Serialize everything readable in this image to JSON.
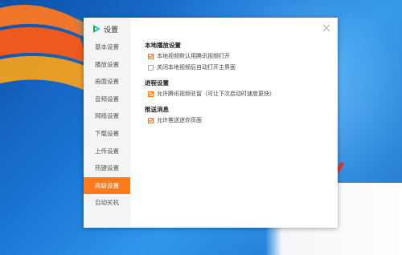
{
  "dialog": {
    "title": "设置",
    "logo_icon": "tencent-video-logo-icon",
    "close_icon": "close-icon",
    "accent_color": "#ff7a1a"
  },
  "sidebar": {
    "items": [
      {
        "label": "基本设置",
        "active": false
      },
      {
        "label": "播放设置",
        "active": false
      },
      {
        "label": "画面设置",
        "active": false
      },
      {
        "label": "音频设置",
        "active": false
      },
      {
        "label": "网络设置",
        "active": false
      },
      {
        "label": "下载设置",
        "active": false
      },
      {
        "label": "上传设置",
        "active": false
      },
      {
        "label": "热键设置",
        "active": false
      },
      {
        "label": "高级设置",
        "active": true
      },
      {
        "label": "自动关机",
        "active": false
      }
    ]
  },
  "sections": [
    {
      "title": "本地播放设置",
      "options": [
        {
          "label": "本地视频默认用腾讯视频打开",
          "checked": true
        },
        {
          "label": "关闭本地视频后自动打开主界面",
          "checked": false
        }
      ]
    },
    {
      "title": "进程设置",
      "options": [
        {
          "label": "允许腾讯视频驻留（可让下次启动时速度更快）",
          "checked": true
        }
      ]
    },
    {
      "title": "推送消息",
      "options": [
        {
          "label": "允许推送迷你页面",
          "checked": true
        }
      ]
    }
  ]
}
